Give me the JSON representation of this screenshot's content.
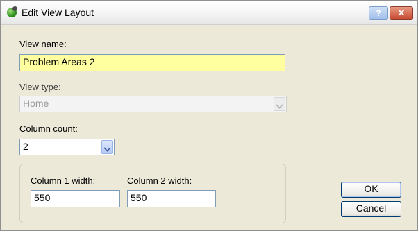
{
  "window": {
    "title": "Edit View Layout",
    "help_label": "?",
    "close_label": "✕"
  },
  "form": {
    "view_name_label": "View name:",
    "view_name_value": "Problem Areas 2",
    "view_type_label": "View type:",
    "view_type_value": "Home",
    "column_count_label": "Column count:",
    "column_count_value": "2",
    "col1_label": "Column 1 width:",
    "col1_value": "550",
    "col2_label": "Column 2 width:",
    "col2_value": "550"
  },
  "buttons": {
    "ok": "OK",
    "cancel": "Cancel"
  }
}
